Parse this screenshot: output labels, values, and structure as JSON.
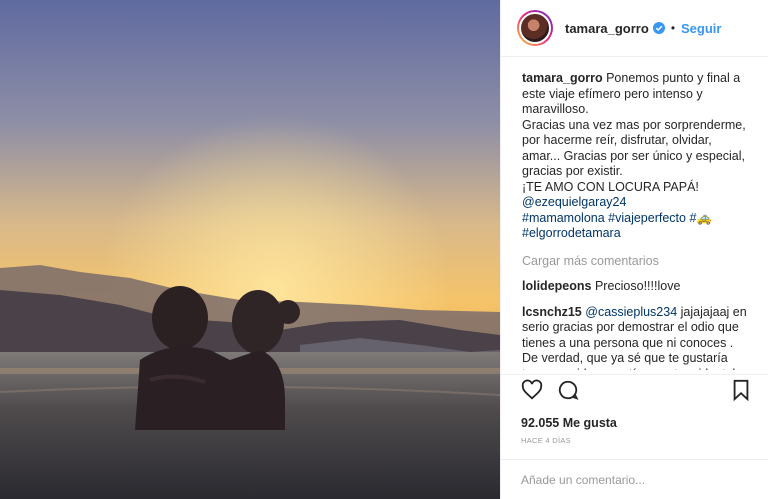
{
  "post": {
    "username": "tamara_gorro",
    "follow_label": "Seguir",
    "separator": "•"
  },
  "caption": {
    "username": "tamara_gorro",
    "text": "Ponemos punto y final a este viaje efímero pero intenso y maravilloso.",
    "line2": "Gracias una vez mas por sorprenderme, por hacerme reír, disfrutar, olvidar, amar... Gracias por ser único y especial, gracias por existir.",
    "line3": "¡TE AMO CON LOCURA PAPÁ!",
    "mention": "@ezequielgaray24",
    "hashtags1": "#mamamolona #viajeperfecto #",
    "emoji": "🚕",
    "hashtags2": "#elgorrodetamara"
  },
  "load_more": "Cargar más comentarios",
  "comments": [
    {
      "user": "lolidepeons",
      "text": "Precioso!!!!love"
    },
    {
      "user": "lcsnchz15",
      "mention": "@cassieplus234",
      "text": "jajajajaaj en serio gracias por demostrar el odio que tienes a una persona que ni conoces . De verdad, que ya sé que te gustaría tener su vida, pero tía, en otra vida, tal vez. Anda maja, quedo mejor yo"
    }
  ],
  "likes": "92.055 Me gusta",
  "time_ago": "HACE 4 DÍAS",
  "add_comment_placeholder": "Añade un comentario...",
  "icons": [
    "heart-icon",
    "comment-icon",
    "bookmark-icon",
    "verified-badge-icon"
  ],
  "colors": {
    "link": "#3897f0",
    "hashtag": "#003569",
    "muted": "#999999",
    "text": "#262626"
  }
}
